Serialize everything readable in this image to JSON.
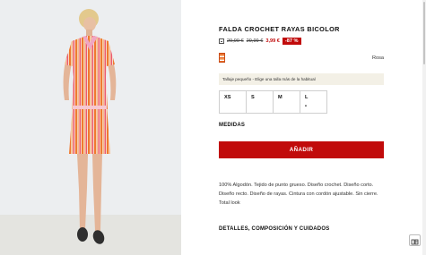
{
  "product": {
    "title": "FALDA CROCHET RAYAS BICOLOR",
    "price_old_1": "29,99 €",
    "price_old_2": "29,99 €",
    "price_new": "3,99 €",
    "discount": "-87 %",
    "color_name": "Rosa",
    "size_notice": "Tallaje pequeño - Elige una talla más de la habitual",
    "sizes": [
      {
        "label": "XS",
        "marker": ""
      },
      {
        "label": "S",
        "marker": ""
      },
      {
        "label": "M",
        "marker": ""
      },
      {
        "label": "L",
        "marker": "•"
      }
    ],
    "measures_label": "MEDIDAS",
    "add_button_label": "AÑADIR",
    "description": "100% Algodón. Tejido de punto grueso. Diseño crochet. Diseño corto. Diseño recto. Diseño de rayas. Cintura con cordón ajustable. Sin cierre. Total look",
    "details_label": "DETALLES, COMPOSICIÓN Y CUIDADOS"
  },
  "colors": {
    "accent": "#c10b0b",
    "notice_bg": "#f3f0e6",
    "photo_bg": "#eceef0"
  },
  "icons": {
    "price_info": "checkbox-icon",
    "swatch": "striped-color-swatch",
    "floating": "document-icon"
  }
}
